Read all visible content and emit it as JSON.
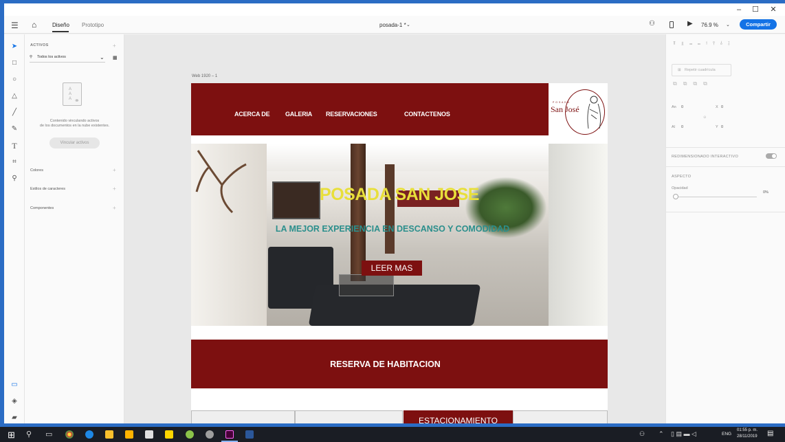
{
  "window": {
    "title": "posada-1 *",
    "minimize": "–",
    "maximize": "☐",
    "close": "✕"
  },
  "appbar": {
    "home_icon": "home-icon",
    "tabs": [
      "Diseño",
      "Prototipo"
    ],
    "zoom": "76.9 %",
    "share": "Compartir"
  },
  "assets": {
    "heading": "ACTIVOS",
    "filter": "Todos los activos",
    "empty_text_1": "Contenido vinculando activos",
    "empty_text_2": "de los documentos en la nube existentes.",
    "link_button": "Vincular activos",
    "sections": [
      "Colores",
      "Estilos de caracteres",
      "Componentes"
    ]
  },
  "artboard": {
    "label": "Web 1920 – 1",
    "nav": [
      "ACERCA DE",
      "GALERIA",
      "RESERVACIONES",
      "CONTACTENOS"
    ],
    "logo": {
      "small": "P O S A D A",
      "name": "San José"
    },
    "hero": {
      "title": "POSADA SAN JOSE",
      "subtitle": "LA MEJOR EXPERIENCIA EN DESCANSO Y COMODIDAD",
      "button": "LEER MAS"
    },
    "reserve": "RESERVA DE HABITACION",
    "bottom": {
      "tab": "ESTACIONAMIENTO"
    }
  },
  "props": {
    "repeat_grid": "Repetir cuadrícula",
    "w_label": "An",
    "w": "0",
    "x_label": "X",
    "x": "0",
    "h_label": "Al",
    "h": "0",
    "y_label": "Y",
    "y": "0",
    "responsive": "REDIMENSIONADO INTERACTIVO",
    "aspect": "ASPECTO",
    "opacity_label": "Opacidad",
    "opacity": "0%"
  },
  "taskbar": {
    "lang": "ENG",
    "time": "01:55 p. m.",
    "date": "28/11/2019"
  },
  "colors": {
    "brand_red": "#7d1010",
    "hero_title": "#e8df3a",
    "hero_subtitle": "#2b8f8c",
    "accent_blue": "#1473e6"
  }
}
